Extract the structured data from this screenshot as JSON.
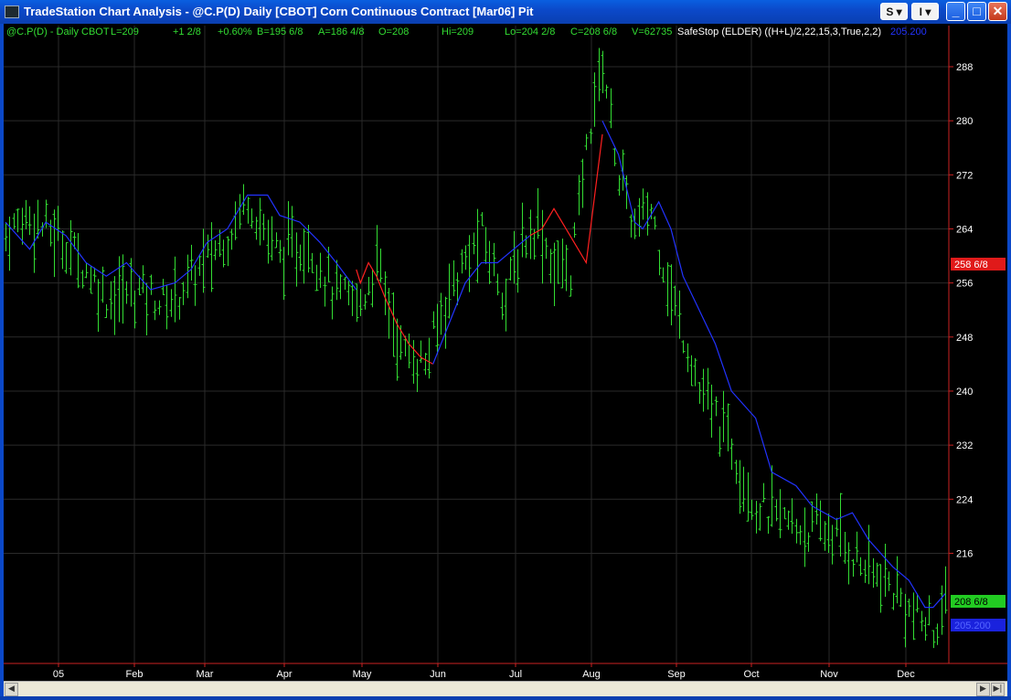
{
  "window": {
    "title": "TradeStation Chart Analysis - @C.P(D)  Daily  [CBOT] Corn Continuous Contract [Mar06] Pit",
    "menu_buttons": [
      "S",
      "I"
    ],
    "window_buttons": {
      "minimize": "_",
      "maximize": "□",
      "close": "✕"
    }
  },
  "status": {
    "symbol": "@C.P(D) - Daily",
    "exchange": "CBOT",
    "last": "L=209",
    "net_change": "+1 2/8",
    "pct_change": "+0.60%",
    "bid": "B=195 6/8",
    "ask": "A=186 4/8",
    "open": "O=208",
    "high": "Hi=209",
    "low": "Lo=204 2/8",
    "close": "C=208 6/8",
    "volume": "V=62735",
    "indicator": "SafeStop (ELDER)  ((H+L)/2,22,15,3,True,2,2)",
    "indicator_value": "205.200"
  },
  "colors": {
    "price_bars": "#33dd33",
    "stop_up": "#2233ff",
    "stop_down": "#ff2020",
    "axis": "#cc2222",
    "grid": "#2a2a2a",
    "tick_text": "#ffffff"
  },
  "chart_data": {
    "type": "ohlc_bar",
    "y_axis": {
      "ticks": [
        216,
        224,
        232,
        240,
        248,
        256,
        264,
        272,
        280,
        288
      ],
      "range": [
        204,
        293
      ]
    },
    "x_tick_labels": [
      "05",
      "Feb",
      "Mar",
      "Apr",
      "May",
      "Jun",
      "Jul",
      "Aug",
      "Sep",
      "Oct",
      "Nov",
      "Dec"
    ],
    "price_path": [
      [
        0,
        263
      ],
      [
        5,
        266
      ],
      [
        15,
        262
      ],
      [
        25,
        254
      ],
      [
        33,
        255
      ],
      [
        40,
        253
      ],
      [
        45,
        256
      ],
      [
        55,
        263
      ],
      [
        60,
        269
      ],
      [
        63,
        265
      ],
      [
        68,
        260
      ],
      [
        75,
        262
      ],
      [
        82,
        254
      ],
      [
        88,
        253
      ],
      [
        92,
        259
      ],
      [
        98,
        246
      ],
      [
        104,
        244
      ],
      [
        110,
        255
      ],
      [
        118,
        263
      ],
      [
        124,
        254
      ],
      [
        128,
        262
      ],
      [
        132,
        265
      ],
      [
        136,
        258
      ],
      [
        140,
        258
      ],
      [
        145,
        280
      ],
      [
        148,
        289
      ],
      [
        152,
        272
      ],
      [
        156,
        264
      ],
      [
        160,
        267
      ],
      [
        165,
        254
      ],
      [
        170,
        245
      ],
      [
        172,
        240
      ],
      [
        180,
        232
      ],
      [
        186,
        223
      ],
      [
        195,
        220
      ],
      [
        205,
        219
      ],
      [
        213,
        214
      ],
      [
        221,
        210
      ],
      [
        226,
        206
      ],
      [
        230,
        205
      ],
      [
        233,
        208
      ]
    ],
    "stop_segments": [
      {
        "dir": "up",
        "points": [
          [
            0,
            265
          ],
          [
            6,
            261
          ],
          [
            10,
            265
          ],
          [
            15,
            263
          ],
          [
            20,
            259
          ],
          [
            25,
            257
          ],
          [
            30,
            259
          ],
          [
            36,
            255
          ],
          [
            42,
            256
          ],
          [
            46,
            258
          ],
          [
            50,
            262
          ],
          [
            55,
            264
          ],
          [
            60,
            269
          ],
          [
            65,
            269
          ],
          [
            68,
            266
          ],
          [
            73,
            265
          ],
          [
            78,
            262
          ],
          [
            82,
            259
          ],
          [
            87,
            255
          ]
        ]
      },
      {
        "dir": "down",
        "points": [
          [
            87,
            258
          ],
          [
            88,
            256
          ],
          [
            90,
            259
          ],
          [
            92,
            257
          ],
          [
            94,
            254
          ],
          [
            97,
            250
          ],
          [
            100,
            247
          ],
          [
            103,
            245
          ],
          [
            106,
            244
          ]
        ]
      },
      {
        "dir": "up",
        "points": [
          [
            106,
            244
          ],
          [
            110,
            250
          ],
          [
            114,
            256
          ],
          [
            118,
            259
          ],
          [
            122,
            259
          ],
          [
            126,
            261
          ],
          [
            130,
            263
          ]
        ]
      },
      {
        "dir": "down",
        "points": [
          [
            130,
            263
          ],
          [
            133,
            264
          ],
          [
            136,
            267
          ],
          [
            140,
            263
          ],
          [
            144,
            259
          ],
          [
            148,
            278
          ]
        ]
      },
      {
        "dir": "up",
        "points": [
          [
            148,
            280
          ],
          [
            152,
            275
          ],
          [
            156,
            265
          ],
          [
            158,
            264
          ],
          [
            162,
            268
          ],
          [
            165,
            264
          ],
          [
            168,
            257
          ],
          [
            172,
            252
          ],
          [
            176,
            247
          ],
          [
            180,
            240
          ],
          [
            186,
            236
          ],
          [
            190,
            228
          ],
          [
            196,
            226
          ],
          [
            200,
            223
          ],
          [
            206,
            221
          ],
          [
            210,
            222
          ],
          [
            214,
            218
          ],
          [
            220,
            214
          ],
          [
            224,
            212
          ],
          [
            228,
            208
          ],
          [
            230,
            208
          ],
          [
            233,
            210
          ]
        ]
      }
    ],
    "last_price": "208 6/8",
    "indicator_last": "205.200",
    "prior_stop_label": "258 6/8"
  }
}
